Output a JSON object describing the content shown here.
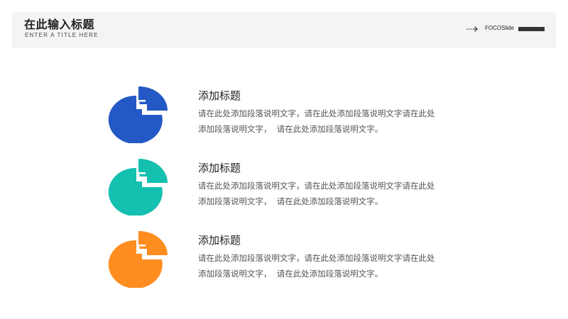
{
  "header": {
    "title": "在此输入标题",
    "subtitle": "ENTER A TITLE HERE",
    "brand": "FOCOSlide"
  },
  "items": [
    {
      "title": "添加标题",
      "line1": "请在此处添加段落说明文字，请在此处添加段落说明文字请在此处",
      "line2": "添加段落说明文字，  请在此处添加段落说明文字。",
      "color": "#2458c4",
      "icon": "pie-chart-icon"
    },
    {
      "title": "添加标题",
      "line1": "请在此处添加段落说明文字，请在此处添加段落说明文字请在此处",
      "line2": "添加段落说明文字，  请在此处添加段落说明文字。",
      "color": "#14c0b0",
      "icon": "pie-chart-icon"
    },
    {
      "title": "添加标题",
      "line1": "请在此处添加段落说明文字，请在此处添加段落说明文字请在此处",
      "line2": "添加段落说明文字，  请在此处添加段落说明文字。",
      "color": "#ff8d1f",
      "icon": "pie-chart-icon"
    }
  ]
}
